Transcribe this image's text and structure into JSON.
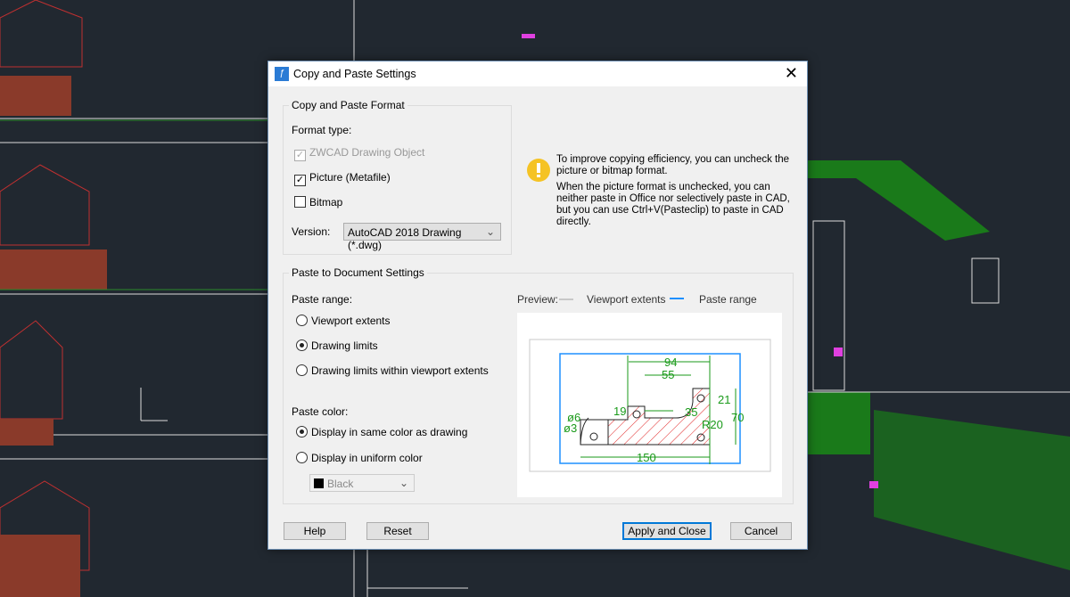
{
  "dialog": {
    "title": "Copy and Paste Settings",
    "close_icon": "close-icon",
    "format_group": {
      "legend": "Copy and Paste Format",
      "format_type_label": "Format type:",
      "options": [
        {
          "label": "ZWCAD Drawing Object",
          "checked": true,
          "disabled": true
        },
        {
          "label": "Picture (Metafile)",
          "checked": true,
          "disabled": false
        },
        {
          "label": "Bitmap",
          "checked": false,
          "disabled": false
        }
      ],
      "version_label": "Version:",
      "version_value": "AutoCAD 2018 Drawing (*.dwg)"
    },
    "info": {
      "icon": "lightbulb-icon",
      "text1": "To improve copying efficiency, you can uncheck the picture or bitmap format.",
      "text2": "When the picture format is unchecked, you can neither paste in Office nor selectively paste in CAD, but you can use Ctrl+V(Pasteclip) to paste in CAD directly."
    },
    "paste_group": {
      "legend": "Paste to Document Settings",
      "range_label": "Paste range:",
      "range_options": [
        {
          "label": "Viewport extents",
          "selected": false
        },
        {
          "label": "Drawing limits",
          "selected": true
        },
        {
          "label": "Drawing limits within viewport extents",
          "selected": false
        }
      ],
      "color_label": "Paste color:",
      "color_options": [
        {
          "label": "Display in same color as drawing",
          "selected": true
        },
        {
          "label": "Display in uniform color",
          "selected": false
        }
      ],
      "color_value": "Black",
      "preview_label": "Preview:",
      "legend_viewport": "Viewport extents",
      "legend_paste": "Paste range",
      "colors": {
        "viewport": "#c8c8c8",
        "paste": "#1e90ff",
        "dims": "#1a9a1a",
        "hatch": "#e02020"
      },
      "dims": {
        "d94": "94",
        "d55": "55",
        "d21": "21",
        "d19": "19",
        "d35": "35",
        "d70": "70",
        "r20": "R20",
        "phi6": "ø6",
        "phi3": "ø3",
        "d150": "150"
      }
    },
    "buttons": {
      "help": "Help",
      "reset": "Reset",
      "apply": "Apply and Close",
      "cancel": "Cancel"
    }
  }
}
